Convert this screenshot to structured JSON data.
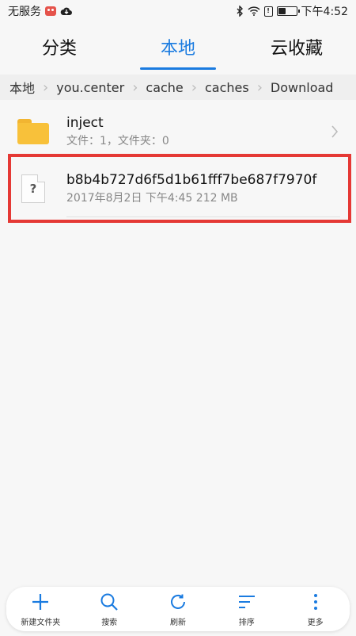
{
  "status_bar": {
    "carrier": "无服务",
    "time": "下午4:52"
  },
  "tabs": [
    {
      "label": "分类",
      "active": false
    },
    {
      "label": "本地",
      "active": true
    },
    {
      "label": "云收藏",
      "active": false
    }
  ],
  "breadcrumb": [
    "本地",
    "you.center",
    "cache",
    "caches",
    "Download"
  ],
  "files": [
    {
      "name": "inject",
      "meta": "文件：1，文件夹：0",
      "type": "folder"
    },
    {
      "name": "b8b4b727d6f5d1b61fff7be687f7970f",
      "meta": "2017年8月2日 下午4:45 212 MB",
      "type": "unknown"
    }
  ],
  "toolbar": {
    "new_folder": "新建文件夹",
    "search": "搜索",
    "refresh": "刷新",
    "sort": "排序",
    "more": "更多"
  },
  "colors": {
    "accent": "#1a7be0",
    "highlight": "#e53935",
    "folder": "#f8c13a"
  }
}
